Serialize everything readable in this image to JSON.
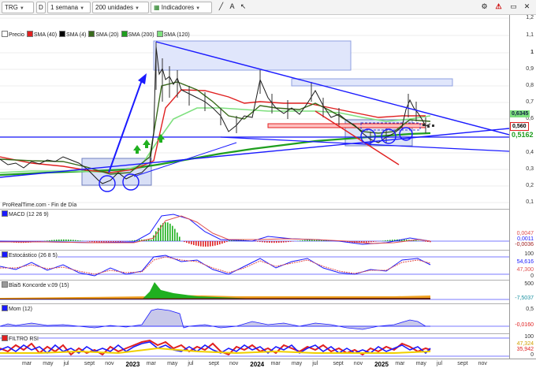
{
  "toolbar": {
    "ticker": "TRG",
    "period_icon": "D",
    "period": "1 semana",
    "units": "200 unidades",
    "indicators": "Indicadores"
  },
  "legend": [
    {
      "label": "Precio",
      "color": "#ffffff"
    },
    {
      "label": "SMA (40)",
      "color": "#e02020"
    },
    {
      "label": "SMA (4)",
      "color": "#000000"
    },
    {
      "label": "SMA (20)",
      "color": "#3a6b1c"
    },
    {
      "label": "SMA (200)",
      "color": "#1f9e1f"
    },
    {
      "label": "SMA (120)",
      "color": "#7ee07e"
    }
  ],
  "source": "ProRealTime.com - Fin de Día",
  "price_axis": [
    "1,2",
    "1,1",
    "1",
    "0,9",
    "0,8",
    "0,7",
    "0,6",
    "0,5",
    "0,4",
    "0,3",
    "0,2",
    "0,1"
  ],
  "price_tags": {
    "t1": "0,6345",
    "t2": "0,560",
    "t3": "0,5162"
  },
  "panels": {
    "macd": {
      "label": "MACD (12 26 9)",
      "v1": "0,0047",
      "v2": "0,0011",
      "v3": "-0,0036"
    },
    "stoch": {
      "label": "Estocástico (26 8 5)",
      "top": "100",
      "v1": "54,616",
      "v2": "47,300",
      "bottom": "0"
    },
    "koncorde": {
      "label": "Blai5 Koncorde v.09 (15)",
      "top": "500",
      "v1": "-7,5037"
    },
    "mom": {
      "label": "Mom (12)",
      "top": "0,5",
      "v1": "-0,0160"
    },
    "rsi": {
      "label": "FILTRO RSI",
      "top": "100",
      "v1": "47,324",
      "v2": "35,942",
      "bottom": "0"
    }
  },
  "dates": [
    {
      "label": "mar",
      "year": false
    },
    {
      "label": "may",
      "year": false
    },
    {
      "label": "jul",
      "year": false
    },
    {
      "label": "sept",
      "year": false
    },
    {
      "label": "nov",
      "year": false
    },
    {
      "label": "2023",
      "year": true
    },
    {
      "label": "mar",
      "year": false
    },
    {
      "label": "may",
      "year": false
    },
    {
      "label": "jul",
      "year": false
    },
    {
      "label": "sept",
      "year": false
    },
    {
      "label": "nov",
      "year": false
    },
    {
      "label": "2024",
      "year": true
    },
    {
      "label": "mar",
      "year": false
    },
    {
      "label": "may",
      "year": false
    },
    {
      "label": "jul",
      "year": false
    },
    {
      "label": "sept",
      "year": false
    },
    {
      "label": "nov",
      "year": false
    },
    {
      "label": "2025",
      "year": true
    },
    {
      "label": "mar",
      "year": false
    },
    {
      "label": "may",
      "year": false
    },
    {
      "label": "jul",
      "year": false
    },
    {
      "label": "sept",
      "year": false
    },
    {
      "label": "nov",
      "year": false
    }
  ],
  "colors": {
    "accent_blue": "#1a1aff",
    "sma40": "#e02020",
    "sma20": "#3a6b1c",
    "sma200": "#1f9e1f",
    "sma120": "#7ee07e"
  }
}
